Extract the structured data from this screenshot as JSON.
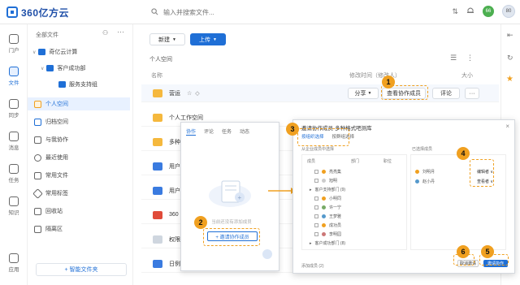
{
  "app": {
    "logo_text": "360亿方云"
  },
  "search": {
    "placeholder": "输入并搜索文件..."
  },
  "user": {
    "avatar_green_text": "66",
    "avatar_text": "80"
  },
  "rail": [
    {
      "label": "门户"
    },
    {
      "label": "文件"
    },
    {
      "label": "同步"
    },
    {
      "label": "消息"
    },
    {
      "label": "任务"
    },
    {
      "label": "知识"
    },
    {
      "label": "应用"
    }
  ],
  "tree": {
    "header": "全部文件",
    "items": [
      {
        "label": "奇亿云计算"
      },
      {
        "label": "客户成功部"
      },
      {
        "label": "服务支持组"
      },
      {
        "label": "个人空间"
      },
      {
        "label": "归档空间"
      },
      {
        "label": "与我协作"
      },
      {
        "label": "最近使用"
      },
      {
        "label": "常用文件"
      },
      {
        "label": "常用标签"
      },
      {
        "label": "回收站"
      },
      {
        "label": "隔离区"
      }
    ],
    "smart_folder": "+ 智能文件夹"
  },
  "main": {
    "new_label": "新建",
    "upload_label": "上传",
    "breadcrumb": "个人空间",
    "col_name": "名称",
    "col_modified": "修改时间（修改人）",
    "col_size": "大小",
    "rows": [
      {
        "name": "营运",
        "type": "folder"
      },
      {
        "name": "个人工作空间",
        "type": "folder"
      },
      {
        "name": "多种格式",
        "type": "folder"
      },
      {
        "name": "用户",
        "type": "doc-blue"
      },
      {
        "name": "用户",
        "type": "doc-blue"
      },
      {
        "name": "360",
        "type": "doc-red"
      },
      {
        "name": "权限",
        "type": "doc-gray"
      },
      {
        "name": "日例",
        "type": "doc-blue"
      }
    ],
    "share_label": "分享",
    "view_collab_label": "查看协作成员",
    "comment_label": "评论",
    "more_label": "···"
  },
  "popup1": {
    "tabs": [
      "协作",
      "评论",
      "任务",
      "动态"
    ],
    "hint": "当前还没有添加成员",
    "invite_button": "+ 邀请协作成员"
  },
  "modal": {
    "title": "邀请协作成员-多种格式吧测库",
    "tabs": [
      "按组织选择",
      "按群组选择"
    ],
    "left_header": "从企业成员中选择",
    "col_a": "成员",
    "col_b": "部门",
    "col_c": "职位",
    "members": [
      "亮亮集",
      "旭明",
      "客户支持部门 (9)",
      "小明同",
      "许一宁",
      "王梦雅",
      "成功员",
      "李明园",
      "客户成功部门 (8)"
    ],
    "right_header": "已选择成员",
    "right_members": [
      "刘明月",
      "赵小丹"
    ],
    "role_a": "编辑者 ∨",
    "role_b": "查看者 ∨",
    "footer_text": "添加成员 (2)",
    "cancel": "取消邀请",
    "confirm": "邀请协作"
  },
  "badges": [
    "1",
    "2",
    "3",
    "4",
    "5",
    "6"
  ],
  "colors": {
    "accent": "#1f6fd6",
    "annotation": "#f0a020"
  }
}
